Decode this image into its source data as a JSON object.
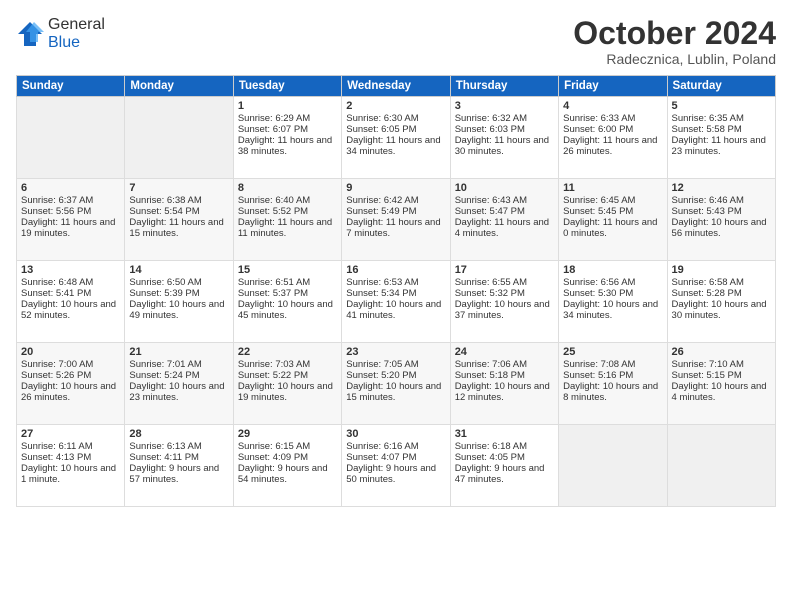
{
  "logo": {
    "general": "General",
    "blue": "Blue"
  },
  "header": {
    "month": "October 2024",
    "location": "Radecznica, Lublin, Poland"
  },
  "weekdays": [
    "Sunday",
    "Monday",
    "Tuesday",
    "Wednesday",
    "Thursday",
    "Friday",
    "Saturday"
  ],
  "weeks": [
    [
      {
        "day": "",
        "empty": true
      },
      {
        "day": "",
        "empty": true
      },
      {
        "day": "1",
        "sunrise": "Sunrise: 6:29 AM",
        "sunset": "Sunset: 6:07 PM",
        "daylight": "Daylight: 11 hours and 38 minutes."
      },
      {
        "day": "2",
        "sunrise": "Sunrise: 6:30 AM",
        "sunset": "Sunset: 6:05 PM",
        "daylight": "Daylight: 11 hours and 34 minutes."
      },
      {
        "day": "3",
        "sunrise": "Sunrise: 6:32 AM",
        "sunset": "Sunset: 6:03 PM",
        "daylight": "Daylight: 11 hours and 30 minutes."
      },
      {
        "day": "4",
        "sunrise": "Sunrise: 6:33 AM",
        "sunset": "Sunset: 6:00 PM",
        "daylight": "Daylight: 11 hours and 26 minutes."
      },
      {
        "day": "5",
        "sunrise": "Sunrise: 6:35 AM",
        "sunset": "Sunset: 5:58 PM",
        "daylight": "Daylight: 11 hours and 23 minutes."
      }
    ],
    [
      {
        "day": "6",
        "sunrise": "Sunrise: 6:37 AM",
        "sunset": "Sunset: 5:56 PM",
        "daylight": "Daylight: 11 hours and 19 minutes."
      },
      {
        "day": "7",
        "sunrise": "Sunrise: 6:38 AM",
        "sunset": "Sunset: 5:54 PM",
        "daylight": "Daylight: 11 hours and 15 minutes."
      },
      {
        "day": "8",
        "sunrise": "Sunrise: 6:40 AM",
        "sunset": "Sunset: 5:52 PM",
        "daylight": "Daylight: 11 hours and 11 minutes."
      },
      {
        "day": "9",
        "sunrise": "Sunrise: 6:42 AM",
        "sunset": "Sunset: 5:49 PM",
        "daylight": "Daylight: 11 hours and 7 minutes."
      },
      {
        "day": "10",
        "sunrise": "Sunrise: 6:43 AM",
        "sunset": "Sunset: 5:47 PM",
        "daylight": "Daylight: 11 hours and 4 minutes."
      },
      {
        "day": "11",
        "sunrise": "Sunrise: 6:45 AM",
        "sunset": "Sunset: 5:45 PM",
        "daylight": "Daylight: 11 hours and 0 minutes."
      },
      {
        "day": "12",
        "sunrise": "Sunrise: 6:46 AM",
        "sunset": "Sunset: 5:43 PM",
        "daylight": "Daylight: 10 hours and 56 minutes."
      }
    ],
    [
      {
        "day": "13",
        "sunrise": "Sunrise: 6:48 AM",
        "sunset": "Sunset: 5:41 PM",
        "daylight": "Daylight: 10 hours and 52 minutes."
      },
      {
        "day": "14",
        "sunrise": "Sunrise: 6:50 AM",
        "sunset": "Sunset: 5:39 PM",
        "daylight": "Daylight: 10 hours and 49 minutes."
      },
      {
        "day": "15",
        "sunrise": "Sunrise: 6:51 AM",
        "sunset": "Sunset: 5:37 PM",
        "daylight": "Daylight: 10 hours and 45 minutes."
      },
      {
        "day": "16",
        "sunrise": "Sunrise: 6:53 AM",
        "sunset": "Sunset: 5:34 PM",
        "daylight": "Daylight: 10 hours and 41 minutes."
      },
      {
        "day": "17",
        "sunrise": "Sunrise: 6:55 AM",
        "sunset": "Sunset: 5:32 PM",
        "daylight": "Daylight: 10 hours and 37 minutes."
      },
      {
        "day": "18",
        "sunrise": "Sunrise: 6:56 AM",
        "sunset": "Sunset: 5:30 PM",
        "daylight": "Daylight: 10 hours and 34 minutes."
      },
      {
        "day": "19",
        "sunrise": "Sunrise: 6:58 AM",
        "sunset": "Sunset: 5:28 PM",
        "daylight": "Daylight: 10 hours and 30 minutes."
      }
    ],
    [
      {
        "day": "20",
        "sunrise": "Sunrise: 7:00 AM",
        "sunset": "Sunset: 5:26 PM",
        "daylight": "Daylight: 10 hours and 26 minutes."
      },
      {
        "day": "21",
        "sunrise": "Sunrise: 7:01 AM",
        "sunset": "Sunset: 5:24 PM",
        "daylight": "Daylight: 10 hours and 23 minutes."
      },
      {
        "day": "22",
        "sunrise": "Sunrise: 7:03 AM",
        "sunset": "Sunset: 5:22 PM",
        "daylight": "Daylight: 10 hours and 19 minutes."
      },
      {
        "day": "23",
        "sunrise": "Sunrise: 7:05 AM",
        "sunset": "Sunset: 5:20 PM",
        "daylight": "Daylight: 10 hours and 15 minutes."
      },
      {
        "day": "24",
        "sunrise": "Sunrise: 7:06 AM",
        "sunset": "Sunset: 5:18 PM",
        "daylight": "Daylight: 10 hours and 12 minutes."
      },
      {
        "day": "25",
        "sunrise": "Sunrise: 7:08 AM",
        "sunset": "Sunset: 5:16 PM",
        "daylight": "Daylight: 10 hours and 8 minutes."
      },
      {
        "day": "26",
        "sunrise": "Sunrise: 7:10 AM",
        "sunset": "Sunset: 5:15 PM",
        "daylight": "Daylight: 10 hours and 4 minutes."
      }
    ],
    [
      {
        "day": "27",
        "sunrise": "Sunrise: 6:11 AM",
        "sunset": "Sunset: 4:13 PM",
        "daylight": "Daylight: 10 hours and 1 minute."
      },
      {
        "day": "28",
        "sunrise": "Sunrise: 6:13 AM",
        "sunset": "Sunset: 4:11 PM",
        "daylight": "Daylight: 9 hours and 57 minutes."
      },
      {
        "day": "29",
        "sunrise": "Sunrise: 6:15 AM",
        "sunset": "Sunset: 4:09 PM",
        "daylight": "Daylight: 9 hours and 54 minutes."
      },
      {
        "day": "30",
        "sunrise": "Sunrise: 6:16 AM",
        "sunset": "Sunset: 4:07 PM",
        "daylight": "Daylight: 9 hours and 50 minutes."
      },
      {
        "day": "31",
        "sunrise": "Sunrise: 6:18 AM",
        "sunset": "Sunset: 4:05 PM",
        "daylight": "Daylight: 9 hours and 47 minutes."
      },
      {
        "day": "",
        "empty": true
      },
      {
        "day": "",
        "empty": true
      }
    ]
  ]
}
